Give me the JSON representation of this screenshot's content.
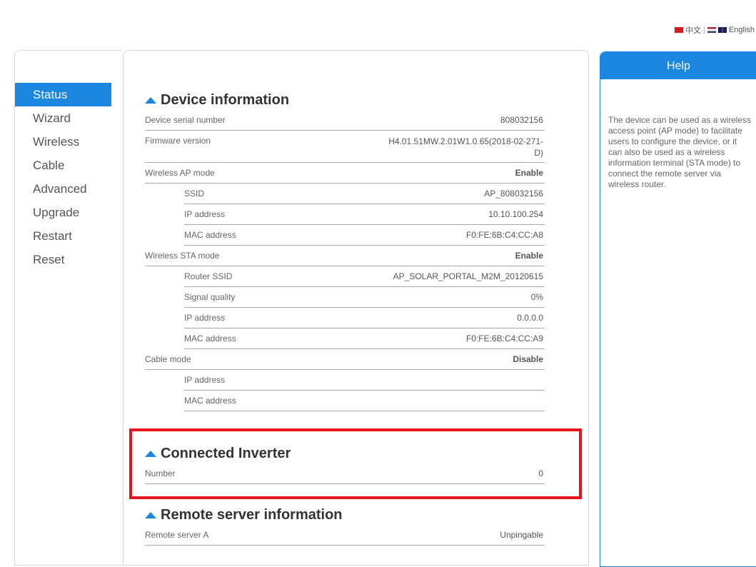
{
  "language": {
    "chinese_label": "中文",
    "separator": "|",
    "english_label": "English"
  },
  "nav": {
    "items": [
      {
        "label": "Status"
      },
      {
        "label": "Wizard"
      },
      {
        "label": "Wireless"
      },
      {
        "label": "Cable"
      },
      {
        "label": "Advanced"
      },
      {
        "label": "Upgrade"
      },
      {
        "label": "Restart"
      },
      {
        "label": "Reset"
      }
    ]
  },
  "device_info": {
    "title": "Device information",
    "serial": {
      "label": "Device serial number",
      "value": "808032156"
    },
    "firmware": {
      "label": "Firmware version",
      "value": "H4.01.51MW.2.01W1.0.65(2018-02-271-D)"
    },
    "ap_mode": {
      "label": "Wireless AP mode",
      "value": "Enable"
    },
    "ap_ssid": {
      "label": "SSID",
      "value": "AP_808032156"
    },
    "ap_ip": {
      "label": "IP address",
      "value": "10.10.100.254"
    },
    "ap_mac": {
      "label": "MAC address",
      "value": "F0:FE:6B:C4:CC:A8"
    },
    "sta_mode": {
      "label": "Wireless STA mode",
      "value": "Enable"
    },
    "router_ssid": {
      "label": "Router SSID",
      "value": "AP_SOLAR_PORTAL_M2M_20120615"
    },
    "signal": {
      "label": "Signal quality",
      "value": "0%"
    },
    "sta_ip": {
      "label": "IP address",
      "value": "0.0.0.0"
    },
    "sta_mac": {
      "label": "MAC address",
      "value": "F0:FE:6B:C4:CC:A9"
    },
    "cable_mode": {
      "label": "Cable mode",
      "value": "Disable"
    },
    "cable_ip": {
      "label": "IP address",
      "value": ""
    },
    "cable_mac": {
      "label": "MAC address",
      "value": ""
    }
  },
  "inverter": {
    "title": "Connected Inverter",
    "number": {
      "label": "Number",
      "value": "0"
    }
  },
  "remote": {
    "title": "Remote server information",
    "server_a": {
      "label": "Remote server A",
      "value": "Unpingable"
    }
  },
  "help": {
    "title": "Help",
    "text": "The device can be used as a wireless access point (AP mode) to facilitate users to configure the device, or it can also be used as a wireless information terminal (STA mode) to connect the remote server via wireless router."
  }
}
